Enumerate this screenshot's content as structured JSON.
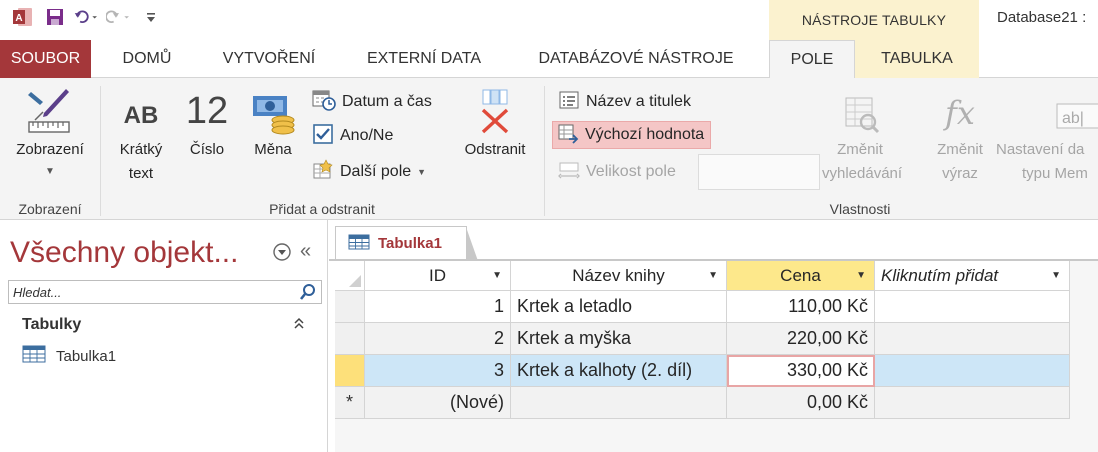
{
  "title_bar": {
    "contextual_tools": "NÁSTROJE TABULKY",
    "document_title": "Database21 :"
  },
  "tabs": [
    {
      "label": "SOUBOR"
    },
    {
      "label": "DOMŮ"
    },
    {
      "label": "VYTVOŘENÍ"
    },
    {
      "label": "EXTERNÍ DATA"
    },
    {
      "label": "DATABÁZOVÉ NÁSTROJE"
    },
    {
      "label": "POLE"
    },
    {
      "label": "TABULKA"
    }
  ],
  "ribbon": {
    "views": {
      "view_label": "Zobrazení",
      "group_label": "Zobrazení"
    },
    "add_delete": {
      "short_text_line1": "Krátký",
      "short_text_line2": "text",
      "short_text_icon": "AB",
      "number": "Číslo",
      "number_icon": "12",
      "currency": "Měna",
      "date_time": "Datum a čas",
      "yes_no": "Ano/Ne",
      "more_fields": "Další pole",
      "delete": "Odstranit",
      "group_label": "Přidat a odstranit"
    },
    "properties": {
      "name_caption": "Název a titulek",
      "default_value": "Výchozí hodnota",
      "field_size": "Velikost pole",
      "modify_lookups_line1": "Změnit",
      "modify_lookups_line2": "vyhledávání",
      "modify_expression_line1": "Změnit",
      "modify_expression_line2": "výraz",
      "memo_settings_line1": "Nastavení da",
      "memo_settings_line2": "typu Mem",
      "group_label": "Vlastnosti"
    }
  },
  "nav_pane": {
    "header": "Všechny objekt...",
    "search_placeholder": "Hledat...",
    "section": "Tabulky",
    "items": [
      {
        "label": "Tabulka1"
      }
    ]
  },
  "document": {
    "tab_label": "Tabulka1",
    "columns": [
      {
        "label": "ID"
      },
      {
        "label": "Název knihy"
      },
      {
        "label": "Cena"
      },
      {
        "label": "Kliknutím přidat"
      }
    ],
    "rows": [
      {
        "id": "1",
        "name": "Krtek a letadlo",
        "price": "110,00 Kč"
      },
      {
        "id": "2",
        "name": "Krtek a myška",
        "price": "220,00 Kč"
      },
      {
        "id": "3",
        "name": "Krtek a kalhoty (2. díl)",
        "price": "330,00 Kč"
      }
    ],
    "new_row": {
      "marker": "*",
      "id": "(Nové)",
      "price": "0,00 Kč"
    }
  },
  "colors": {
    "accent": "#a4373a",
    "selected_header": "#fde88b",
    "current_row": "#cde6f7",
    "contextual_tab": "#fbf2cf"
  }
}
